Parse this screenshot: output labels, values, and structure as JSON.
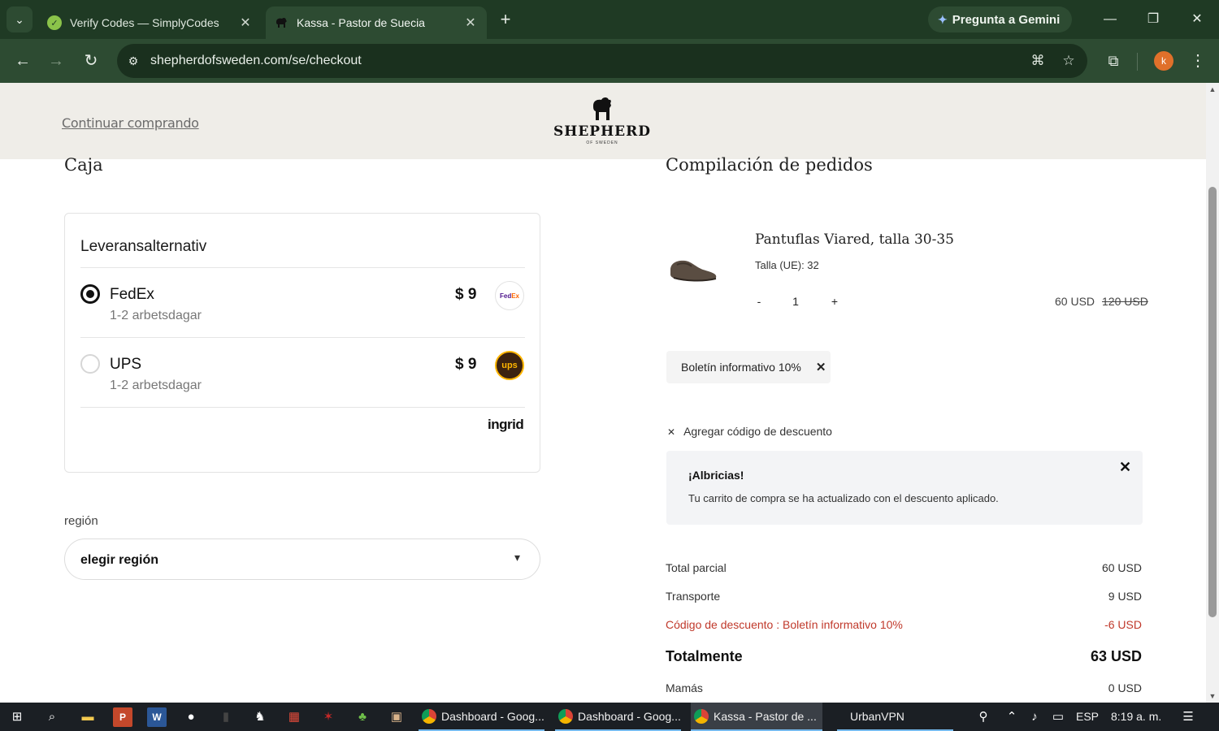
{
  "browser": {
    "tabs": [
      {
        "title": "Verify Codes — SimplyCodes",
        "active": false
      },
      {
        "title": "Kassa - Pastor de Suecia",
        "active": true
      }
    ],
    "gemini_label": "Pregunta a Gemini",
    "url": "shepherdofsweden.com/se/checkout",
    "profile_initial": "k"
  },
  "header": {
    "continue_link": "Continuar comprando",
    "logo_brand": "SHEPHERD",
    "logo_sub": "OF SWEDEN"
  },
  "checkout": {
    "title": "Caja",
    "shipping": {
      "title": "Leveransalternativ",
      "options": [
        {
          "carrier": "FedEx",
          "days": "1-2 arbetsdagar",
          "price": "$ 9",
          "selected": true,
          "logo_text_a": "Fed",
          "logo_text_b": "Ex"
        },
        {
          "carrier": "UPS",
          "days": "1-2 arbetsdagar",
          "price": "$ 9",
          "selected": false,
          "logo_text": "ups"
        }
      ],
      "provider": "ingrid"
    },
    "region_label": "región",
    "region_value": "elegir región"
  },
  "summary": {
    "title": "Compilación de pedidos",
    "product": {
      "name": "Pantuflas Viared, talla 30-35",
      "size": "Talla (UE): 32",
      "qty_minus": "-",
      "qty": "1",
      "qty_plus": "+",
      "price": "60 USD",
      "price_old": "120 USD"
    },
    "coupon_chip": "Boletín informativo 10%",
    "add_code": "Agregar código de descuento",
    "notice": {
      "title": "¡Albricias!",
      "message": "Tu carrito de compra se ha actualizado con el descuento aplicado."
    },
    "rows": {
      "subtotal_label": "Total parcial",
      "subtotal_value": "60 USD",
      "shipping_label": "Transporte",
      "shipping_value": "9 USD",
      "discount_label": "Código de descuento : Boletín informativo 10%",
      "discount_value": "-6 USD",
      "total_label": "Totalmente",
      "total_value": "63 USD",
      "mamas_label": "Mamás",
      "mamas_value": "0 USD"
    }
  },
  "taskbar": {
    "apps": [
      {
        "label": "Dashboard - Goog..."
      },
      {
        "label": "Dashboard - Goog..."
      },
      {
        "label": "Kassa - Pastor de ..."
      }
    ],
    "vpn": "UrbanVPN",
    "lang": "ESP",
    "time": "8:19 a. m."
  },
  "colors": {
    "chrome_dark": "#1f3a24",
    "chrome_mid": "#2d4b32",
    "header_bg": "#efede8",
    "discount_red": "#c0392b"
  }
}
